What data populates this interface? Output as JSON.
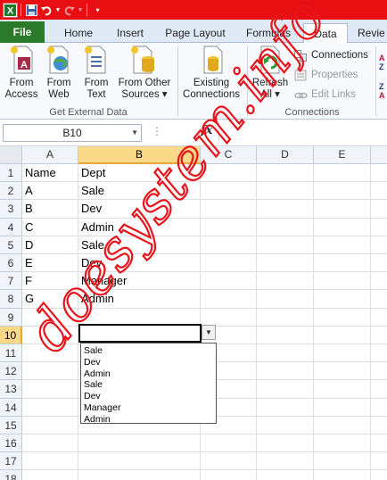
{
  "quick_access": {
    "icons": [
      "excel-app-icon",
      "save-icon",
      "undo-icon",
      "redo-icon",
      "customize-qat-icon"
    ]
  },
  "tabs": [
    {
      "label": "File"
    },
    {
      "label": "Home"
    },
    {
      "label": "Insert"
    },
    {
      "label": "Page Layout"
    },
    {
      "label": "Formulas"
    },
    {
      "label": "Data"
    },
    {
      "label": "Review"
    }
  ],
  "tab_visible": [
    "File",
    "Home",
    "Insert",
    "Page Layout",
    "Formulas",
    "Data",
    "Revie"
  ],
  "ribbon": {
    "get_external": {
      "from_access": [
        "From",
        "Access"
      ],
      "from_web": [
        "From",
        "Web"
      ],
      "from_text": [
        "From",
        "Text"
      ],
      "from_other": [
        "From Other",
        "Sources ▾"
      ],
      "label": "Get External Data"
    },
    "existing": [
      "Existing",
      "Connections"
    ],
    "refresh": [
      "Refresh",
      "All ▾"
    ],
    "connections_group": {
      "connections": "Connections",
      "properties": "Properties",
      "edit_links": "Edit Links",
      "label": "Connections"
    }
  },
  "formula_bar": {
    "name_box": "B10",
    "fx": "fx",
    "dots": "⋮",
    "value": ""
  },
  "columns": [
    "A",
    "B",
    "C",
    "D",
    "E"
  ],
  "rows": [
    "1",
    "2",
    "3",
    "4",
    "5",
    "6",
    "7",
    "8",
    "9",
    "10",
    "11",
    "12",
    "13",
    "14",
    "15",
    "16",
    "17",
    "18"
  ],
  "cells": {
    "A": [
      "Name",
      "A",
      "B",
      "C",
      "D",
      "E",
      "F",
      "G"
    ],
    "B": [
      "Dept",
      "Sale",
      "Dev",
      "Admin",
      "Sale",
      "Dev",
      "Manager",
      "Admin"
    ]
  },
  "dropdown": {
    "options": [
      "Sale",
      "Dev",
      "Admin",
      "Sale",
      "Dev",
      "Manager",
      "Admin"
    ]
  },
  "watermark": "doesystem.info",
  "colors": {
    "title_bar": "#e80f12",
    "file_tab": "#2a7a2a",
    "selection": "#f9d987",
    "watermark": "#e8141b"
  }
}
